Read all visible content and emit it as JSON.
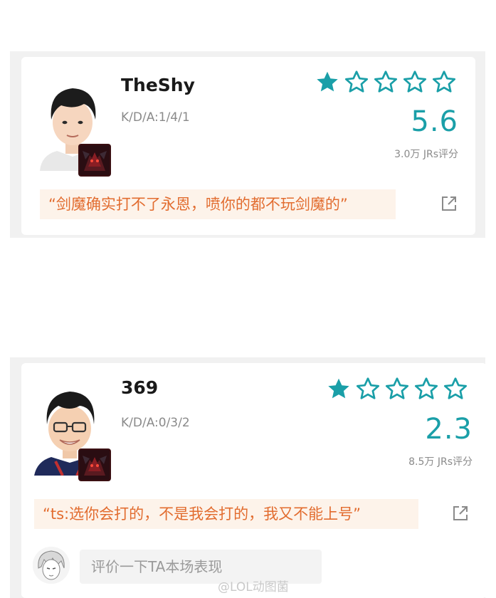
{
  "players": [
    {
      "name": "TheShy",
      "kda": "K/D/A:1/4/1",
      "stars_filled": 1,
      "stars_total": 5,
      "score": "5.6",
      "rating_count": "3.0万 JRs评分",
      "quote": "“剑魔确实打不了永恩，喷你的都不玩剑魔的”",
      "avatar_icon": "player-portrait",
      "champion_icon": "champion-aatrox-icon"
    },
    {
      "name": "369",
      "kda": "K/D/A:0/3/2",
      "stars_filled": 1,
      "stars_total": 5,
      "score": "2.3",
      "rating_count": "8.5万 JRs评分",
      "quote": "“ts:选你会打的，不是我会打的，我又不能上号”",
      "avatar_icon": "player-portrait",
      "champion_icon": "champion-aatrox-icon"
    }
  ],
  "comment": {
    "placeholder": "评价一下TA本场表现"
  },
  "watermark": "@LOL动图菌",
  "colors": {
    "accent_teal": "#1a9fa8",
    "quote_text": "#e26c2f",
    "quote_bg": "#fdf3ea"
  }
}
